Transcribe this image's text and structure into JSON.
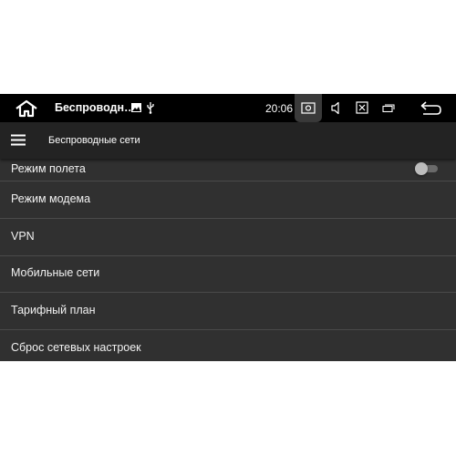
{
  "statusbar": {
    "title": "Беспроводн…",
    "time": "20:06",
    "icons": [
      "home-icon",
      "image-icon",
      "usb-icon",
      "screenshot-icon",
      "volume-icon",
      "close-window-icon",
      "window-icon",
      "back-icon"
    ]
  },
  "appbar": {
    "title": "Беспроводные сети",
    "menu_icon": "menu-icon"
  },
  "list": {
    "items": [
      {
        "label": "Режим полета",
        "toggle": false
      },
      {
        "label": "Режим модема"
      },
      {
        "label": "VPN"
      },
      {
        "label": "Мобильные сети"
      },
      {
        "label": "Тарифный план"
      },
      {
        "label": "Сброс сетевых настроек"
      }
    ]
  }
}
